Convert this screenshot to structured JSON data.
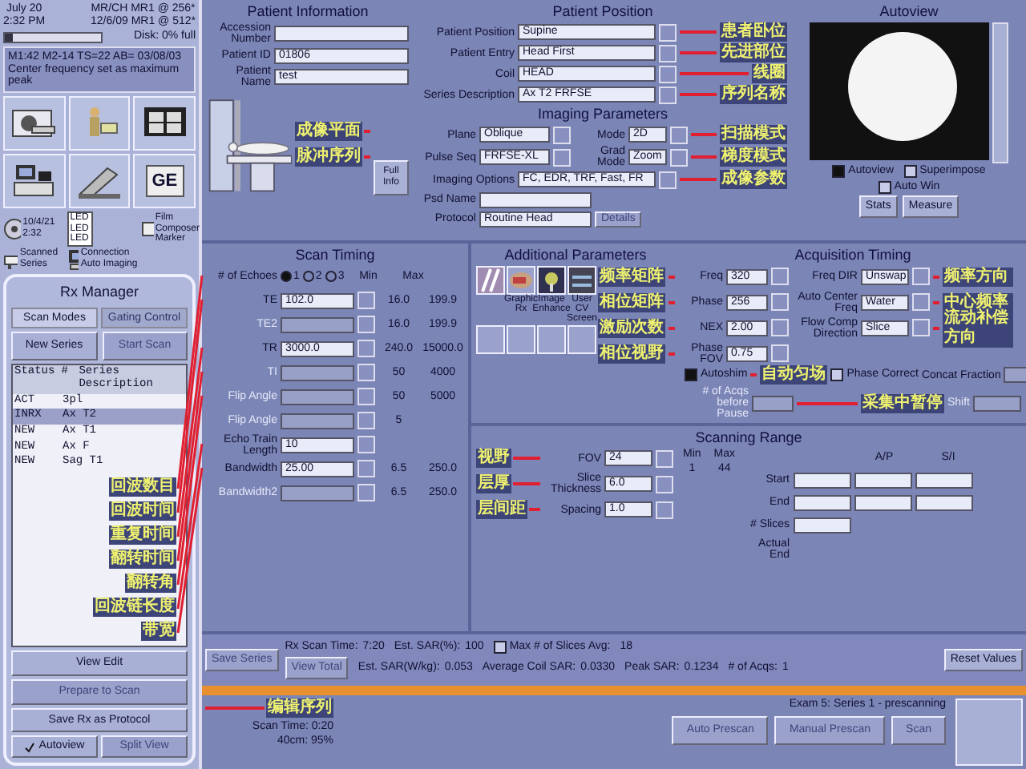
{
  "status": {
    "date": "July 20",
    "time": "2:32 PM",
    "system": [
      "MR/CH MR1 @ 256*",
      "12/6/09 MR1 @ 512*"
    ],
    "disk": {
      "label": "Disk: 0% full",
      "level": 0.08
    },
    "message": "M1:42 M2-14 TS=22 AB= 03/08/03 Center frequency set as maximum peak"
  },
  "tools": [
    {
      "kind": "scanner"
    },
    {
      "kind": "patient"
    },
    {
      "kind": "monitor"
    },
    {
      "kind": "workstation"
    },
    {
      "kind": "gantry"
    },
    {
      "kind": "logo",
      "label": "GE"
    }
  ],
  "shortcuts": [
    {
      "kind": "disc",
      "label": "10/4/21 2:32"
    },
    {
      "kind": "list",
      "label": "LED LED LED"
    },
    {
      "kind": "film",
      "label": "Film Composer Marker"
    },
    {
      "kind": "table",
      "label": "Scanned Series"
    },
    {
      "kind": "computer",
      "label": "Connection Auto Imaging"
    }
  ],
  "rx_manager": {
    "title": "Rx Manager",
    "tabs": [
      {
        "label": "Scan Modes",
        "selected": true
      },
      {
        "label": "Gating Control",
        "selected": false
      }
    ],
    "buttons": [
      {
        "label": "New Series",
        "disabled": false
      },
      {
        "label": "Start Scan",
        "disabled": true
      }
    ],
    "columns": [
      "Status",
      "#",
      "Series Description"
    ],
    "rows": [
      {
        "status": "ACT",
        "description": "3pl",
        "selected": false
      },
      {
        "status": "INRX",
        "description": "Ax T2",
        "selected": true
      },
      {
        "status": "NEW",
        "description": "Ax T1",
        "selected": false
      },
      {
        "status": "NEW",
        "description": "Ax F",
        "selected": false
      },
      {
        "status": "NEW",
        "description": "Sag T1",
        "selected": false
      }
    ],
    "actions": [
      {
        "label": "View Edit",
        "disabled": false,
        "annotation": "编辑序列"
      },
      {
        "label": "Prepare to Scan",
        "disabled": true
      },
      {
        "label": "Save Rx as Protocol",
        "disabled": false
      }
    ],
    "footer": [
      {
        "label": "Autoview",
        "disabled": false,
        "checked": true
      },
      {
        "label": "Split View",
        "disabled": true,
        "checked": false
      }
    ]
  },
  "patient_information": {
    "title": "Patient Information",
    "fields": [
      {
        "label": "Accession Number"
      },
      {
        "label": "Patient ID",
        "value": "01806"
      },
      {
        "label": "Patient Name",
        "value": "test"
      }
    ],
    "button": "Full Info"
  },
  "patient_position": {
    "title": "Patient Position",
    "fields": [
      {
        "label": "Patient Position",
        "value": "Supine",
        "annotation": "患者卧位"
      },
      {
        "label": "Patient Entry",
        "value": "Head First",
        "annotation": "先进部位"
      },
      {
        "label": "Coil",
        "value": "HEAD",
        "annotation": "线圈"
      },
      {
        "label": "Series Description",
        "value": "Ax T2 FRFSE",
        "annotation": "序列名称"
      }
    ]
  },
  "imaging_parameters": {
    "title": "Imaging Parameters",
    "plane": {
      "label": "Plane",
      "value": "Oblique",
      "annotation": "成像平面"
    },
    "mode": {
      "label": "Mode",
      "value": "2D",
      "annotation": "扫描模式"
    },
    "pulse_seq": {
      "label": "Pulse Seq",
      "value": "FRFSE-XL",
      "annotation": "脉冲序列"
    },
    "grad_mode": {
      "label": "Grad Mode",
      "value": "Zoom",
      "annotation": "梯度模式"
    },
    "imaging_options": {
      "label": "Imaging Options",
      "value": "FC, EDR, TRF, Fast, FR",
      "annotation": "成像参数"
    },
    "psd_name": {
      "label": "Psd Name"
    },
    "protocol": {
      "label": "Protocol",
      "value": "Routine Head"
    },
    "button": "Details"
  },
  "autoview": {
    "title": "Autoview",
    "checks": [
      {
        "label": "Autoview",
        "checked": true
      },
      {
        "label": "Superimpose",
        "checked": false
      },
      {
        "label": "Auto Win",
        "checked": false
      }
    ],
    "buttons": [
      "Stats",
      "Measure"
    ]
  },
  "scan_timing": {
    "title": "Scan Timing",
    "echoes": {
      "label": "# of Echoes",
      "annotation": "回波数目",
      "options": [
        {
          "label": "1",
          "selected": true
        },
        {
          "label": "2",
          "selected": false
        },
        {
          "label": "3",
          "selected": false
        }
      ]
    },
    "min_label": "Min",
    "max_label": "Max",
    "rows": [
      {
        "label": "TE",
        "value": "102.0",
        "disabled": false,
        "min": "16.0",
        "max": "199.9",
        "annotation": "回波时间"
      },
      {
        "label": "TE2",
        "disabled": true,
        "min": "16.0",
        "max": "199.9"
      },
      {
        "label": "TR",
        "value": "3000.0",
        "disabled": false,
        "min": "240.0",
        "max": "15000.0",
        "annotation": "重复时间"
      },
      {
        "label": "TI",
        "disabled": true,
        "min": "50",
        "max": "4000",
        "annotation": "翻转时间"
      },
      {
        "label": "Flip Angle",
        "disabled": true,
        "min": "50",
        "max": "5000",
        "annotation": "翻转角"
      },
      {
        "label": "Flip Angle",
        "disabled": true,
        "min": "5"
      },
      {
        "label": "Echo Train Length",
        "value": "10",
        "disabled": false,
        "annotation": "回波链长度"
      },
      {
        "label": "Bandwidth",
        "value": "25.00",
        "disabled": false,
        "min": "6.5",
        "max": "250.0",
        "annotation": "带宽"
      },
      {
        "label": "Bandwidth2",
        "disabled": true,
        "min": "6.5",
        "max": "250.0"
      }
    ]
  },
  "additional_parameters": {
    "title": "Additional Parameters",
    "tiles": [
      {
        "kind": "stripes"
      },
      {
        "kind": "graphic",
        "label": "Graphic Rx"
      },
      {
        "kind": "enhance",
        "label": "Image Enhance"
      },
      {
        "kind": "screen",
        "label": "User CV Screen"
      },
      {
        "kind": "empty"
      },
      {
        "kind": "empty"
      },
      {
        "kind": "empty"
      },
      {
        "kind": "empty"
      }
    ]
  },
  "acquisition_timing": {
    "title": "Acquisition Timing",
    "fields": [
      {
        "label": "Freq",
        "value": "320",
        "annotation": "频率矩阵"
      },
      {
        "label": "Phase",
        "value": "256",
        "annotation": "相位矩阵"
      },
      {
        "label": "NEX",
        "value": "2.00",
        "annotation": "激励次数"
      },
      {
        "label": "Phase FOV",
        "value": "0.75",
        "annotation": "相位视野"
      }
    ],
    "options": [
      {
        "label": "Freq DIR",
        "value": "Unswap",
        "annotation": "频率方向"
      },
      {
        "label": "Auto Center Freq",
        "value": "Water",
        "annotation": "中心频率"
      },
      {
        "label": "Flow Comp Direction",
        "value": "Slice",
        "annotation": "流动补偿方向"
      }
    ],
    "checks": [
      {
        "label": "Autoshim",
        "checked": true,
        "annotation": "自动匀场"
      },
      {
        "label": "Phase Correct",
        "checked": false
      }
    ],
    "concat": "Concat Fraction",
    "shift": "Shift",
    "pause": {
      "label": "# of Acqs before Pause",
      "annotation": "采集中暂停"
    }
  },
  "scanning_range": {
    "title": "Scanning Range",
    "fields": [
      {
        "label": "FOV",
        "value": "24",
        "annotation": "视野"
      },
      {
        "label": "Slice Thickness",
        "value": "6.0",
        "annotation": "层厚"
      },
      {
        "label": "Spacing",
        "value": "1.0",
        "annotation": "层间距"
      }
    ],
    "min": {
      "label": "Min",
      "value": "1"
    },
    "max": {
      "label": "Max",
      "value": "44"
    },
    "columns": [
      "A/P",
      "S/I"
    ],
    "rows": [
      {
        "label": "Start",
        "kind": "triple"
      },
      {
        "label": "End",
        "kind": "triple"
      },
      {
        "label": "# Slices",
        "kind": "single"
      },
      {
        "label": "Actual End",
        "kind": "text"
      }
    ]
  },
  "summary": {
    "save_series": "Save Series",
    "view_total": "View Total",
    "items": [
      {
        "label": "Rx Scan Time:",
        "value": "7:20"
      },
      {
        "label": "Est. SAR(%):",
        "value": "100"
      },
      {
        "label": "Est. SAR(W/kg):",
        "value": "0.053"
      },
      {
        "label": "Average Coil SAR:",
        "value": "0.0330"
      },
      {
        "label": "Peak SAR:",
        "value": "0.1234"
      },
      {
        "label": "# of Acqs:",
        "value": "1"
      }
    ],
    "max_slices": {
      "label": "Max # of Slices Avg:",
      "value": "18",
      "checked": false
    },
    "reset": "Reset Values"
  },
  "exam": {
    "status": "Exam 5: Series 1 - prescanning",
    "scan_time": "Scan Time: 0:20",
    "coil": "40cm: 95%",
    "buttons": [
      "Auto Prescan",
      "Manual Prescan",
      "Scan"
    ]
  }
}
